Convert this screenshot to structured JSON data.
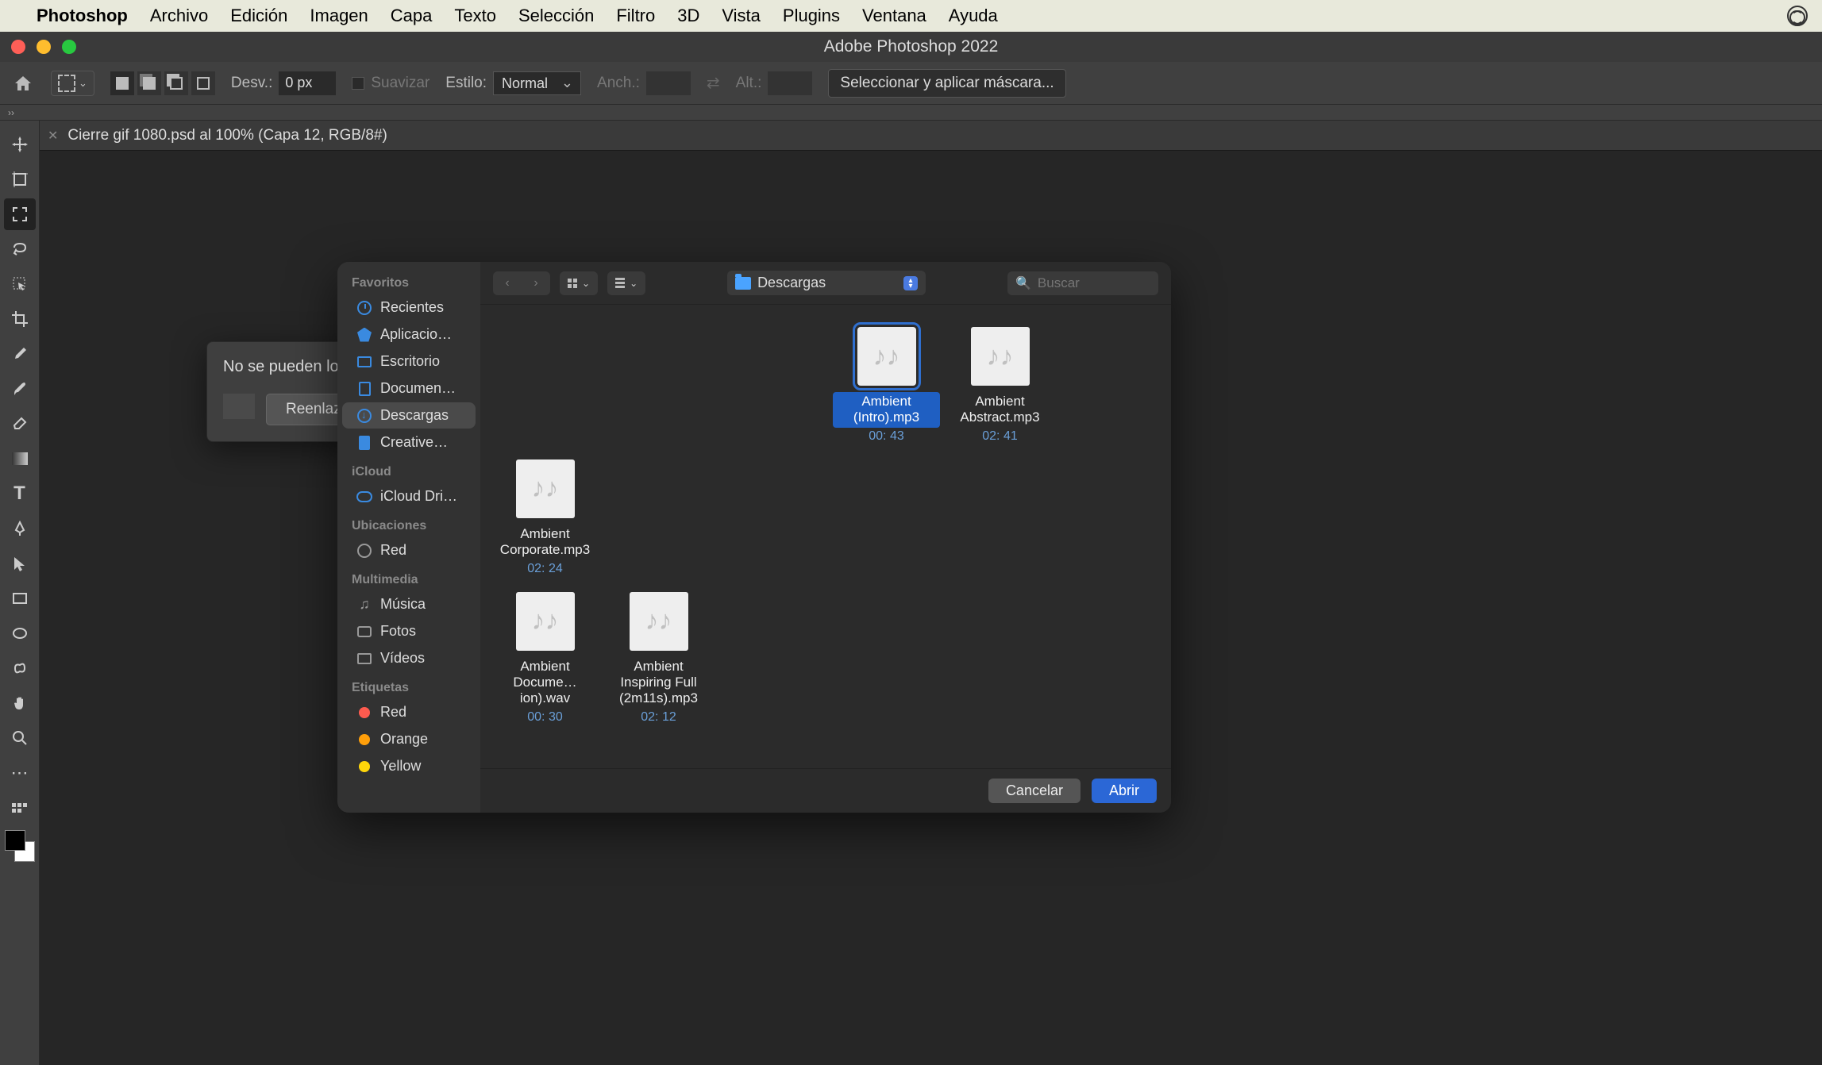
{
  "menubar": {
    "app": "Photoshop",
    "items": [
      "Archivo",
      "Edición",
      "Imagen",
      "Capa",
      "Texto",
      "Selección",
      "Filtro",
      "3D",
      "Vista",
      "Plugins",
      "Ventana",
      "Ayuda"
    ]
  },
  "window": {
    "title": "Adobe Photoshop 2022"
  },
  "options": {
    "desv_label": "Desv.:",
    "desv_value": "0 px",
    "suavizar": "Suavizar",
    "estilo_label": "Estilo:",
    "estilo_value": "Normal",
    "anch_label": "Anch.:",
    "alt_label": "Alt.:",
    "mask_button": "Seleccionar y aplicar máscara..."
  },
  "document_tab": "Cierre gif 1080.psd al 100% (Capa 12, RGB/8#)",
  "link_dialog": {
    "message": "No se pueden localizar",
    "relink_button": "Reenlazar..."
  },
  "file_dialog": {
    "sidebar": {
      "favoritos_label": "Favoritos",
      "favoritos": [
        {
          "icon": "clock",
          "label": "Recientes"
        },
        {
          "icon": "app",
          "label": "Aplicacio…"
        },
        {
          "icon": "desktop",
          "label": "Escritorio"
        },
        {
          "icon": "doc",
          "label": "Documen…"
        },
        {
          "icon": "download",
          "label": "Descargas",
          "selected": true
        },
        {
          "icon": "file",
          "label": "Creative…"
        }
      ],
      "icloud_label": "iCloud",
      "icloud": [
        {
          "icon": "cloud",
          "label": "iCloud Dri…"
        }
      ],
      "ubicaciones_label": "Ubicaciones",
      "ubicaciones": [
        {
          "icon": "globe",
          "label": "Red"
        }
      ],
      "multimedia_label": "Multimedia",
      "multimedia": [
        {
          "icon": "music",
          "label": "Música"
        },
        {
          "icon": "camera",
          "label": "Fotos"
        },
        {
          "icon": "video",
          "label": "Vídeos"
        }
      ],
      "etiquetas_label": "Etiquetas",
      "etiquetas": [
        {
          "color": "#ff5b4f",
          "label": "Red"
        },
        {
          "color": "#ff9f0a",
          "label": "Orange"
        },
        {
          "color": "#ffd60a",
          "label": "Yellow"
        }
      ]
    },
    "location": "Descargas",
    "search_placeholder": "Buscar",
    "files": [
      {
        "name": "Ambient (Intro).mp3",
        "meta": "00: 43",
        "selected": true,
        "row": 1
      },
      {
        "name": "Ambient Abstract.mp3",
        "meta": "02: 41",
        "row": 1
      },
      {
        "name": "Ambient Corporate.mp3",
        "meta": "02: 24",
        "row": 1
      },
      {
        "name": "Ambient Docume…ion).wav",
        "meta": "00: 30",
        "row": 2
      },
      {
        "name": "Ambient Inspiring Full (2m11s).mp3",
        "meta": "02: 12",
        "row": 2
      }
    ],
    "cancel": "Cancelar",
    "open": "Abrir"
  }
}
